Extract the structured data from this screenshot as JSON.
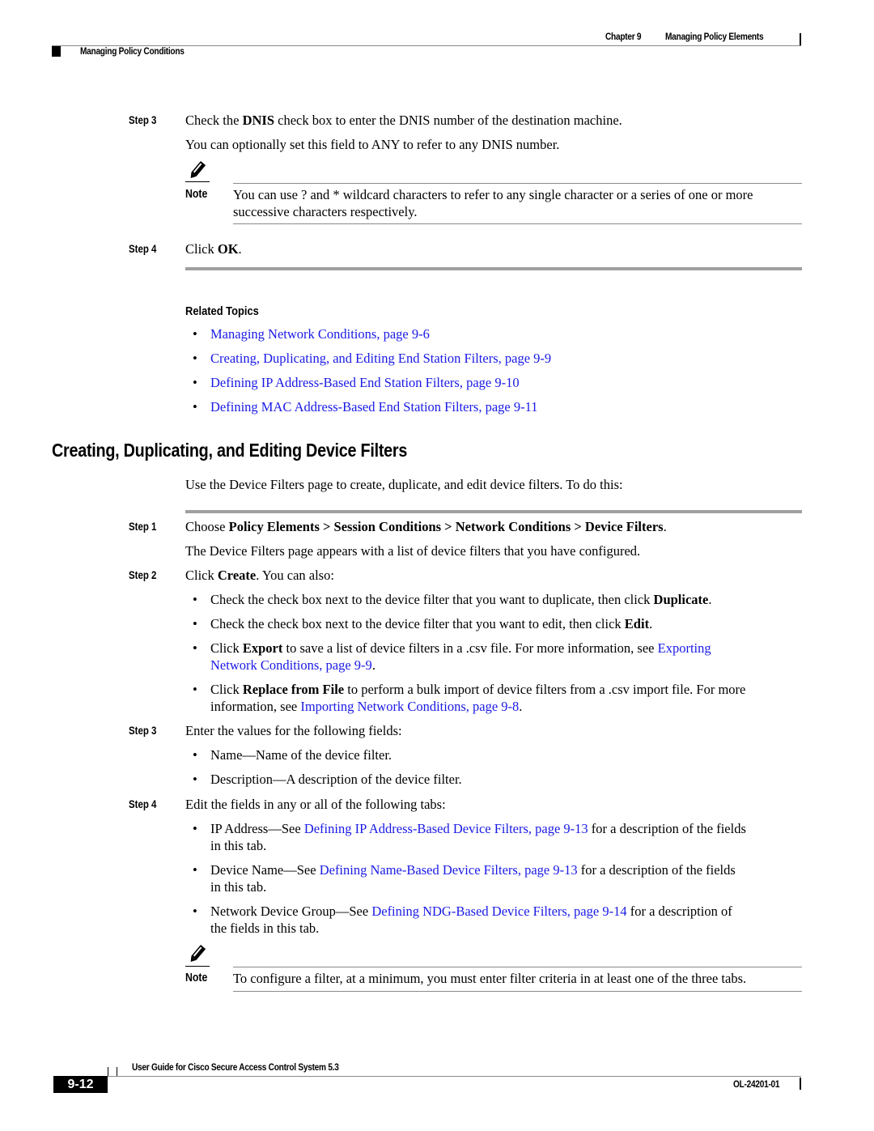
{
  "header": {
    "chapter": "Chapter 9",
    "chapter_title": "Managing Policy Elements",
    "section": "Managing Policy Conditions"
  },
  "top_steps": [
    {
      "label": "Step 3",
      "text_pre": "Check the ",
      "text_bold": "DNIS",
      "text_post": " check box to enter the DNIS number of the destination machine.",
      "sub": "You can optionally set this field to ANY to refer to any DNIS number."
    },
    {
      "label": "Step 4",
      "text_pre": "Click ",
      "text_bold": "OK",
      "text_post": "."
    }
  ],
  "note1": {
    "label": "Note",
    "icon": "pencil-icon",
    "line1": "You can use ? and * wildcard characters to refer to any single character or a series of one or more",
    "line2": "successive characters respectively."
  },
  "related": {
    "title": "Related Topics",
    "links": [
      "Managing Network Conditions, page 9-6",
      "Creating, Duplicating, and Editing End Station Filters, page 9-9",
      "Defining IP Address-Based End Station Filters, page 9-10",
      "Defining MAC Address-Based End Station Filters, page 9-11"
    ]
  },
  "section": {
    "title": "Creating, Duplicating, and Editing Device Filters",
    "intro": "Use the Device Filters page to create, duplicate, and edit device filters. To do this:"
  },
  "steps": {
    "s1": {
      "label": "Step 1",
      "pre": "Choose ",
      "bold": "Policy Elements > Session Conditions > Network Conditions > Device Filters",
      "post": ".",
      "sub": "The Device Filters page appears with a list of device filters that you have configured."
    },
    "s2": {
      "label": "Step 2",
      "pre": "Click ",
      "bold": "Create",
      "post": ". You can also:",
      "bullets": [
        {
          "pre": "Check the check box next to the device filter that you want to duplicate, then click ",
          "bold": "Duplicate",
          "post": "."
        },
        {
          "pre": "Check the check box next to the device filter that you want to edit, then click ",
          "bold": "Edit",
          "post": "."
        },
        {
          "pre": "Click ",
          "bold": "Export",
          "mid": " to save a list of device filters in a .csv file. For more information, see ",
          "link_a": "Exporting",
          "link_b": "Network Conditions, page 9-9",
          "post": "."
        },
        {
          "pre": "Click ",
          "bold": "Replace from File",
          "mid": " to perform a bulk import of device filters from a .csv import file. For more",
          "mid2": "information, see ",
          "link": "Importing Network Conditions, page 9-8",
          "post": "."
        }
      ]
    },
    "s3": {
      "label": "Step 3",
      "text": "Enter the values for the following fields:",
      "bullets": [
        "Name—Name of the device filter.",
        "Description—A description of the device filter."
      ]
    },
    "s4": {
      "label": "Step 4",
      "text": "Edit the fields in any or all of the following tabs:",
      "bullets": [
        {
          "pre": "IP Address—See ",
          "link": "Defining IP Address-Based Device Filters, page 9-13",
          "post": " for a description of the fields",
          "line2": "in this tab."
        },
        {
          "pre": "Device Name—See ",
          "link": "Defining Name-Based Device Filters, page 9-13",
          "post": " for a description of the fields",
          "line2": "in this tab."
        },
        {
          "pre": "Network Device Group—See ",
          "link": "Defining NDG-Based Device Filters, page 9-14",
          "post": " for a description of",
          "line2": "the fields in this tab."
        }
      ]
    }
  },
  "note2": {
    "label": "Note",
    "icon": "pencil-icon",
    "text": "To configure a filter, at a minimum, you must enter filter criteria in at least one of the three tabs."
  },
  "footer": {
    "guide_title": "User Guide for Cisco Secure Access Control System 5.3",
    "page_number": "9-12",
    "doc_id": "OL-24201-01"
  },
  "colors": {
    "link": "#1a1ae6",
    "rule": "#8a8a8a",
    "text": "#000000"
  }
}
